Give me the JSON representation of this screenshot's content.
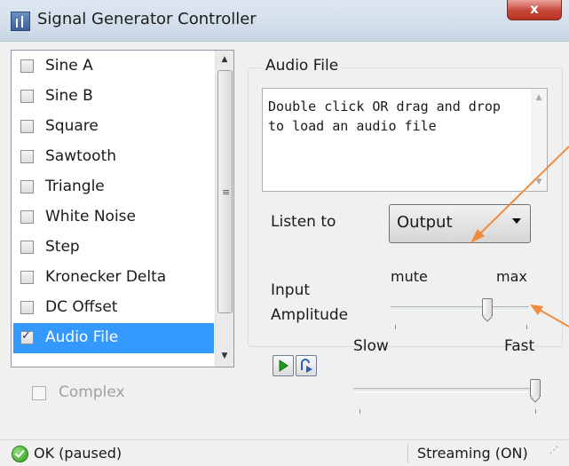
{
  "window": {
    "title": "Signal Generator Controller",
    "close_label": "x"
  },
  "signal_list": {
    "items": [
      {
        "label": "Sine A",
        "checked": false,
        "selected": false
      },
      {
        "label": "Sine B",
        "checked": false,
        "selected": false
      },
      {
        "label": "Square",
        "checked": false,
        "selected": false
      },
      {
        "label": "Sawtooth",
        "checked": false,
        "selected": false
      },
      {
        "label": "Triangle",
        "checked": false,
        "selected": false
      },
      {
        "label": "White Noise",
        "checked": false,
        "selected": false
      },
      {
        "label": "Step",
        "checked": false,
        "selected": false
      },
      {
        "label": "Kronecker Delta",
        "checked": false,
        "selected": false
      },
      {
        "label": "DC Offset",
        "checked": false,
        "selected": false
      },
      {
        "label": "Audio File",
        "checked": true,
        "selected": true
      }
    ]
  },
  "complex": {
    "label": "Complex",
    "checked": false,
    "enabled": false
  },
  "audio_file": {
    "group_title": "Audio File",
    "drop_hint": "Double click OR drag and drop to load an audio file",
    "listen_to_label": "Listen to",
    "listen_to_value": "Output",
    "amplitude_label_line1": "Input",
    "amplitude_label_line2": "Amplitude",
    "amplitude_min_label": "mute",
    "amplitude_max_label": "max",
    "amplitude_level": 0.7
  },
  "playback": {
    "play_icon": "play-icon",
    "step_icon": "step-icon",
    "speed_min_label": "Slow",
    "speed_max_label": "Fast",
    "speed_level": 1.0
  },
  "status": {
    "left_text": "OK (paused)",
    "right_text": "Streaming (ON)",
    "ok_icon": "check-circle-icon"
  },
  "colors": {
    "selection": "#3399ff",
    "annotation_arrow": "#f08a3c",
    "close_button": "#c7463a"
  }
}
